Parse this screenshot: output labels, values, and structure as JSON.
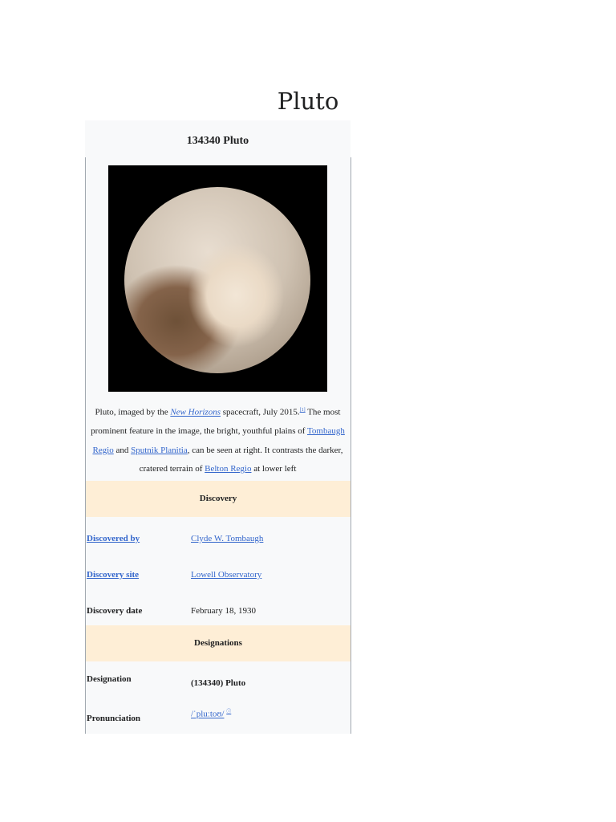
{
  "page": {
    "title": "Pluto"
  },
  "infobox": {
    "title": "134340 Pluto",
    "caption": {
      "t1": "Pluto, imaged by the ",
      "l1": "New Horizons",
      "t2": " spacecraft, July 2015.",
      "ref": "[1]",
      "t3": " The most prominent feature in the image, the bright, youthful plains of ",
      "l2": "Tombaugh Regio",
      "t4": " and ",
      "l3": "Sputnik Planitia",
      "t5": ", can be seen at right. It contrasts the darker, cratered terrain of ",
      "l4": "Belton Regio",
      "t6": " at lower left"
    },
    "discovery": {
      "header": "Discovery",
      "rows": [
        {
          "label": "Discovered by",
          "value": "Clyde W. Tombaugh"
        },
        {
          "label": "Discovery site",
          "value": "Lowell Observatory"
        },
        {
          "label": "Discovery date",
          "value": "February 18, 1930"
        }
      ]
    },
    "designations": {
      "header": "Designations",
      "rows": [
        {
          "label": "Designation",
          "value": "(134340) Pluto"
        },
        {
          "label": "Pronunciation",
          "value": "/ˈpluːtoʊ/",
          "ref": "ⓘ"
        }
      ]
    }
  }
}
